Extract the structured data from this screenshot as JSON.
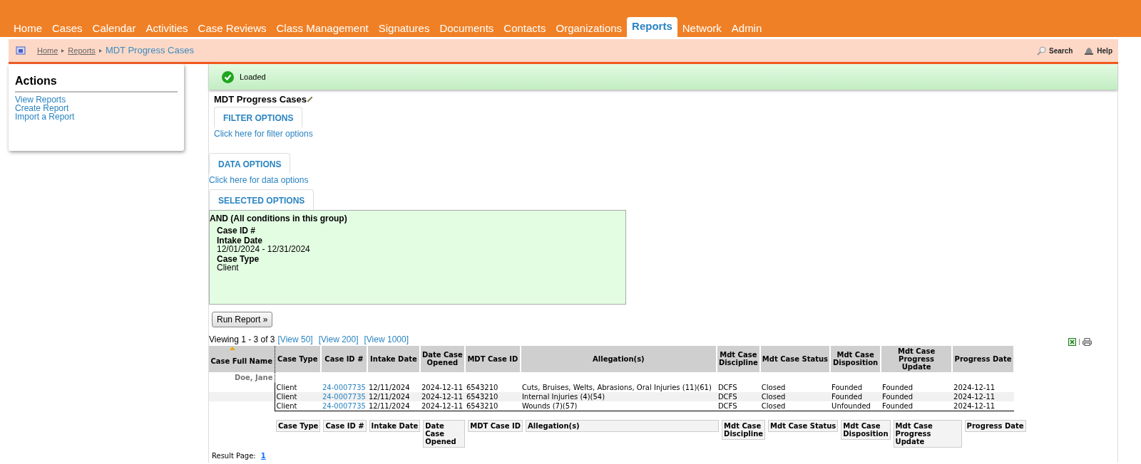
{
  "nav": [
    {
      "label": "Home",
      "selected": false
    },
    {
      "label": "Cases",
      "selected": false
    },
    {
      "label": "Calendar",
      "selected": false
    },
    {
      "label": "Activities",
      "selected": false
    },
    {
      "label": "Case Reviews",
      "selected": false
    },
    {
      "label": "Class Management",
      "selected": false
    },
    {
      "label": "Signatures",
      "selected": false
    },
    {
      "label": "Documents",
      "selected": false
    },
    {
      "label": "Contacts",
      "selected": false
    },
    {
      "label": "Organizations",
      "selected": false
    },
    {
      "label": "Reports",
      "selected": true
    },
    {
      "label": "Network",
      "selected": false
    },
    {
      "label": "Admin",
      "selected": false
    }
  ],
  "breadcrumb": [
    "Home",
    "Reports",
    "MDT Progress Cases"
  ],
  "toolbar": {
    "search": "Search",
    "help": "Help"
  },
  "actions": {
    "title": "Actions",
    "links": [
      "View Reports",
      "Create Report",
      "Import a Report"
    ]
  },
  "status": {
    "message": "Loaded"
  },
  "report": {
    "title": "MDT Progress Cases",
    "filter_options": {
      "tab": "FILTER OPTIONS",
      "link": "Click here for filter options"
    },
    "data_options": {
      "tab": "DATA OPTIONS",
      "link": "Click here for data options"
    },
    "selected_options": {
      "tab": "SELECTED OPTIONS",
      "group": "AND (All conditions in this group)",
      "conditions": [
        {
          "label": "Case ID #"
        },
        {
          "label": "Intake Date",
          "value": "12/01/2024 - 12/31/2024"
        },
        {
          "label": "Case Type",
          "value": "Client"
        }
      ]
    },
    "run_button": "Run Report »",
    "viewing": "Viewing 1 - 3 of 3",
    "view_links": [
      "[View 50]",
      "[View 200]",
      "[View 1000]"
    ],
    "table": {
      "columns": [
        "Case Full Name",
        "Case Type",
        "Case ID #",
        "Intake Date",
        "Date Case Opened",
        "MDT Case ID",
        "Allegation(s)",
        "Mdt Case Discipline",
        "Mdt Case Status",
        "Mdt Case Disposition",
        "Mdt Case Progress Update",
        "Progress Date"
      ],
      "groups": [
        {
          "name": "Doe, Jane",
          "rows": [
            {
              "case_type": "Client",
              "case_id": "24-0007735",
              "intake_date": "12/11/2024",
              "date_opened": "2024-12-11",
              "mdt_case_id": "6543210",
              "allegations": "Cuts, Bruises, Welts, Abrasions, Oral Injuries (11)(61)",
              "discipline": "DCFS",
              "status": "Closed",
              "disposition": "Founded",
              "progress_update": "Founded",
              "progress_date": "2024-12-11"
            },
            {
              "case_type": "Client",
              "case_id": "24-0007735",
              "intake_date": "12/11/2024",
              "date_opened": "2024-12-11",
              "mdt_case_id": "6543210",
              "allegations": "Internal Injuries (4)(54)",
              "discipline": "DCFS",
              "status": "Closed",
              "disposition": "Founded",
              "progress_update": "Founded",
              "progress_date": "2024-12-11"
            },
            {
              "case_type": "Client",
              "case_id": "24-0007735",
              "intake_date": "12/11/2024",
              "date_opened": "2024-12-11",
              "mdt_case_id": "6543210",
              "allegations": "Wounds (7)(57)",
              "discipline": "DCFS",
              "status": "Closed",
              "disposition": "Unfounded",
              "progress_update": "Founded",
              "progress_date": "2024-12-11"
            }
          ]
        }
      ],
      "footer_columns": [
        "Case Type",
        "Case ID #",
        "Intake Date",
        "Date Case Opened",
        "MDT Case ID",
        "Allegation(s)",
        "Mdt Case Discipline",
        "Mdt Case Status",
        "Mdt Case Disposition",
        "Mdt Case Progress Update",
        "Progress Date"
      ]
    },
    "result_page": {
      "label": "Result Page:",
      "page": "1"
    }
  }
}
